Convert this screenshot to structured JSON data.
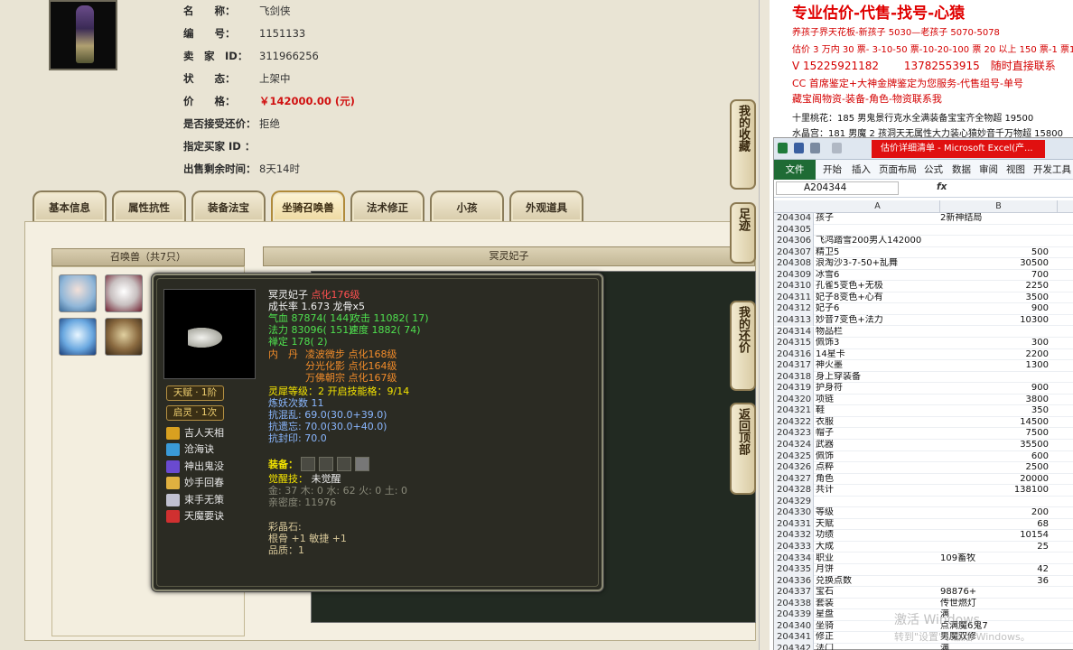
{
  "info": {
    "rows": [
      {
        "key": "名　　称：",
        "value": "飞剑侠"
      },
      {
        "key": "编　　号：",
        "value": "1151133"
      },
      {
        "key": "卖　家　ID：",
        "value": "311966256"
      },
      {
        "key": "状　　态：",
        "value": "上架中"
      },
      {
        "key": "价　　格：",
        "value": "￥142000.00 (元)"
      },
      {
        "key": "是否接受还价：",
        "value": "拒绝"
      },
      {
        "key": "指定买家 ID ：",
        "value": ""
      },
      {
        "key": "出售剩余时间：",
        "value": "8天14时"
      }
    ]
  },
  "tabs": [
    "基本信息",
    "属性抗性",
    "装备法宝",
    "坐骑召唤兽",
    "法术修正",
    "小孩",
    "外观道具"
  ],
  "summon": {
    "header": "召唤兽（共7只）",
    "detail_header": "冥灵妃子"
  },
  "tooltip": {
    "name": "冥灵妃子",
    "level": "点化176级",
    "growth": "成长率 1.673 龙骨x5",
    "hp": "气血 87874( 144)",
    "attack": "攻击 11082( 17)",
    "mp": "法力 83096( 151)",
    "speed": "速度 1882( 74)",
    "zen": "禅定 178( 2)",
    "dan_label": "内　丹",
    "dan1": "凌波微步 点化168级",
    "dan2": "分光化影 点化164级",
    "dan3": "万佛朝宗 点化167级",
    "talent_badge": "天赋 · 1阶",
    "spirit_badge": "启灵 · 1次",
    "lingxi": "灵犀等级：2 开启技能格：9/14",
    "refine": "炼妖次数 11",
    "res1": "抗混乱: 69.0(30.0+39.0)",
    "res2": "抗遗忘: 70.0(30.0+40.0)",
    "res3": "抗封印: 70.0",
    "equip_label": "装备：",
    "awaken_label": "觉醒技：",
    "awaken_value": "未觉醒",
    "elements": "金: 37 木: 0 水: 62 火: 0 土: 0",
    "intimacy": "亲密度: 11976",
    "gem_label": "彩晶石:",
    "gem1": "根骨 +1 敏捷 +1",
    "gem2": "品质：1",
    "skills": [
      "吉人天相",
      "沧海诀",
      "神出鬼没",
      "妙手回春",
      "束手无策",
      "天魔要诀"
    ]
  },
  "side_buttons": [
    "我的收藏",
    "足迹",
    "我的还价",
    "返回顶部"
  ],
  "doc": {
    "title": "专业估价-代售-找号-心猿",
    "line1": "养孩子界天花板-新孩子 5030—老孩子 5070-5078",
    "line2": "估价 3 万内 30 票- 3-10-50 票-10-20-100 票 20 以上 150 票-1 票1",
    "line3": "V 15225921182　　 13782553915　随时直接联系",
    "line4": "CC 首席鉴定+大神金牌鉴定为您服务-代售组号-单号",
    "line5": "藏宝阁物资-装备-角色-物资联系我",
    "line6": "十里桃花：185 男鬼景行克水全满装备宝宝齐全物超 19500",
    "line7": "水晶宫：181 男魔 2 孩洞天无属性大力装心猿妙音千万物超 15800"
  },
  "excel": {
    "title": "估价详细清单 - Microsoft Excel(产...",
    "ribbon": [
      "文件",
      "开始",
      "插入",
      "页面布局",
      "公式",
      "数据",
      "审阅",
      "视图",
      "开发工具"
    ],
    "namebox": "A204344",
    "fx": "fx",
    "col_a": "A",
    "col_b": "B",
    "rows": [
      {
        "n": "204304",
        "a": "孩子",
        "b": "2新神结局",
        "num": false
      },
      {
        "n": "204305",
        "a": "",
        "b": "",
        "num": false
      },
      {
        "n": "204306",
        "a": "飞鸿踏雪200男人142000",
        "b": "",
        "num": false
      },
      {
        "n": "204307",
        "a": "精卫5",
        "b": "500",
        "num": true
      },
      {
        "n": "204308",
        "a": "浪淘沙3-7-50+乱舞",
        "b": "30500",
        "num": true
      },
      {
        "n": "204309",
        "a": "冰雪6",
        "b": "700",
        "num": true
      },
      {
        "n": "204310",
        "a": "孔雀5变色+无极",
        "b": "2250",
        "num": true
      },
      {
        "n": "204311",
        "a": "妃子8变色+心有",
        "b": "3500",
        "num": true
      },
      {
        "n": "204312",
        "a": "妃子6",
        "b": "900",
        "num": true
      },
      {
        "n": "204313",
        "a": "妙音7变色+法力",
        "b": "10300",
        "num": true
      },
      {
        "n": "204314",
        "a": "物品栏",
        "b": "",
        "num": false
      },
      {
        "n": "204315",
        "a": "佩饰3",
        "b": "300",
        "num": true
      },
      {
        "n": "204316",
        "a": "14星卡",
        "b": "2200",
        "num": true
      },
      {
        "n": "204317",
        "a": "神火墨",
        "b": "1300",
        "num": true
      },
      {
        "n": "204318",
        "a": "身上穿装备",
        "b": "",
        "num": false
      },
      {
        "n": "204319",
        "a": "护身符",
        "b": "900",
        "num": true
      },
      {
        "n": "204320",
        "a": "项链",
        "b": "3800",
        "num": true
      },
      {
        "n": "204321",
        "a": "鞋",
        "b": "350",
        "num": true
      },
      {
        "n": "204322",
        "a": "衣服",
        "b": "14500",
        "num": true
      },
      {
        "n": "204323",
        "a": "帽子",
        "b": "7500",
        "num": true
      },
      {
        "n": "204324",
        "a": "武器",
        "b": "35500",
        "num": true
      },
      {
        "n": "204325",
        "a": "佩饰",
        "b": "600",
        "num": true
      },
      {
        "n": "204326",
        "a": "点粹",
        "b": "2500",
        "num": true
      },
      {
        "n": "204327",
        "a": "角色",
        "b": "20000",
        "num": true
      },
      {
        "n": "204328",
        "a": "共计",
        "b": "138100",
        "num": true
      },
      {
        "n": "204329",
        "a": "",
        "b": "",
        "num": false
      },
      {
        "n": "204330",
        "a": "等级",
        "b": "200",
        "num": true
      },
      {
        "n": "204331",
        "a": "天赋",
        "b": "68",
        "num": true
      },
      {
        "n": "204332",
        "a": "功绩",
        "b": "10154",
        "num": true
      },
      {
        "n": "204333",
        "a": "大成",
        "b": "25",
        "num": true
      },
      {
        "n": "204334",
        "a": "职业",
        "b": "109畜牧",
        "num": false
      },
      {
        "n": "204335",
        "a": "月饼",
        "b": "42",
        "num": true
      },
      {
        "n": "204336",
        "a": "兑换点数",
        "b": "36",
        "num": true
      },
      {
        "n": "204337",
        "a": "宝石",
        "b": "98876+",
        "num": false
      },
      {
        "n": "204338",
        "a": "套装",
        "b": "传世燃灯",
        "num": false
      },
      {
        "n": "204339",
        "a": "星盘",
        "b": "满",
        "num": false
      },
      {
        "n": "204340",
        "a": "坐骑",
        "b": "点满魔6鬼7",
        "num": false
      },
      {
        "n": "204341",
        "a": "修正",
        "b": "男魔双修",
        "num": false
      },
      {
        "n": "204342",
        "a": "法门",
        "b": "满",
        "num": false
      }
    ]
  },
  "watermark": {
    "line1": "激活 Windows",
    "line2": "转到\"设置\"以激活 Windows。"
  }
}
